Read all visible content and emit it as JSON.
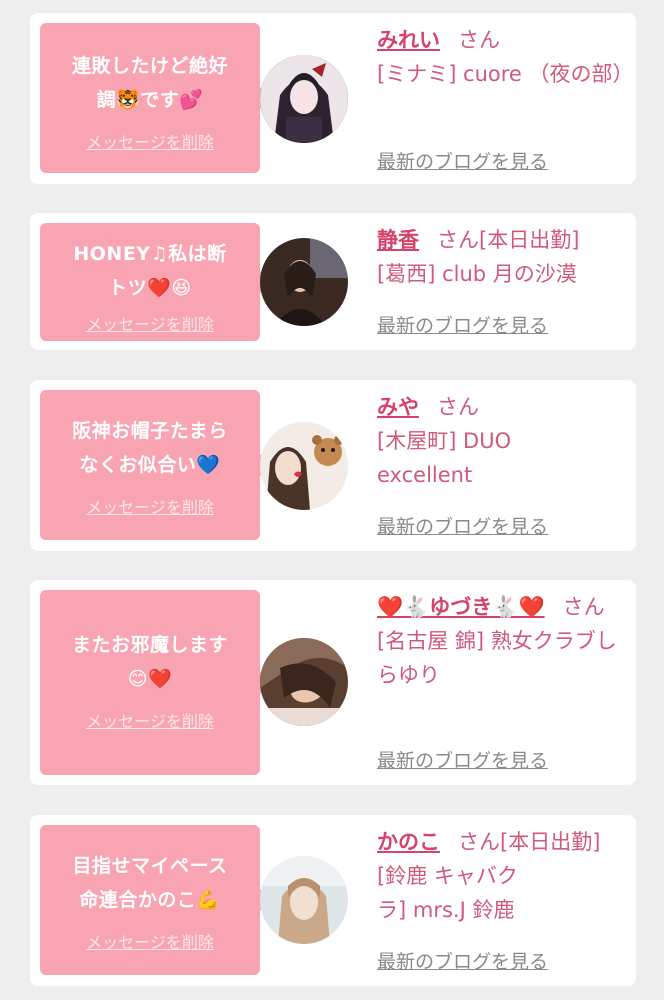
{
  "cards": [
    {
      "message_line1": "連敗したけど絶好",
      "message_line2": "調🐯です💕",
      "delete_label": "メッセージを削除",
      "name": "みれい",
      "suffix": "さん",
      "shop": "[ミナミ] cuore （夜の部）",
      "blog_label": "最新のブログを見る"
    },
    {
      "message_line1": "HONEY♫私は断",
      "message_line2": "トツ❤️😆",
      "delete_label": "メッセージを削除",
      "name": "静香",
      "suffix": "さん[本日出勤]",
      "shop": "[葛西] club 月の沙漠",
      "blog_label": "最新のブログを見る"
    },
    {
      "message_line1": "阪神お帽子たまら",
      "message_line2": "なくお似合い💙",
      "delete_label": "メッセージを削除",
      "name": "みや",
      "suffix": "さん",
      "shop": "[木屋町] DUO excellent",
      "blog_label": "最新のブログを見る"
    },
    {
      "message_line1": "またお邪魔します",
      "message_line2": "😊❤️",
      "delete_label": "メッセージを削除",
      "name": "❤️🐇ゆづき🐇❤️",
      "suffix": "さん",
      "shop": "[名古屋 錦] 熟女クラブしらゆり",
      "blog_label": "最新のブログを見る"
    },
    {
      "message_line1": "目指せマイペース",
      "message_line2": "命連合かのこ💪",
      "delete_label": "メッセージを削除",
      "name": "かのこ",
      "suffix": "さん[本日出勤]",
      "shop": "[鈴鹿 キャバクラ] mrs.J 鈴鹿",
      "blog_label": "最新のブログを見る"
    }
  ]
}
